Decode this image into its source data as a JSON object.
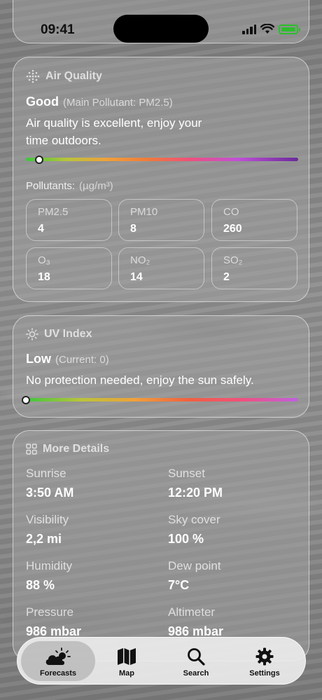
{
  "status_bar": {
    "time": "09:41"
  },
  "air_quality": {
    "header": "Air Quality",
    "level": "Good",
    "main_pollutant": "(Main Pollutant: PM2.5)",
    "description_line1": "Air quality is excellent, enjoy your",
    "description_line2": "time outdoors.",
    "scale_position": 0.05,
    "pollutants_label": "Pollutants:",
    "pollutants_unit": "(µg/m³)",
    "pollutants": [
      {
        "name": "PM2.5",
        "value": "4"
      },
      {
        "name": "PM10",
        "value": "8"
      },
      {
        "name": "CO",
        "value": "260"
      },
      {
        "name": "O₃",
        "value": "18"
      },
      {
        "name": "NO₂",
        "value": "14"
      },
      {
        "name": "SO₂",
        "value": "2"
      }
    ]
  },
  "uv_index": {
    "header": "UV Index",
    "level": "Low",
    "current": "(Current: 0)",
    "description": "No protection needed, enjoy the sun safely.",
    "scale_position": 0.0
  },
  "more_details": {
    "header": "More Details",
    "items": [
      {
        "label": "Sunrise",
        "value": "3:50 AM"
      },
      {
        "label": "Sunset",
        "value": "12:20 PM"
      },
      {
        "label": "Visibility",
        "value": "2,2 mi"
      },
      {
        "label": "Sky cover",
        "value": "100 %"
      },
      {
        "label": "Humidity",
        "value": "88 %"
      },
      {
        "label": "Dew point",
        "value": "7°C"
      },
      {
        "label": "Pressure",
        "value": "986 mbar"
      },
      {
        "label": "Altimeter",
        "value": "986 mbar"
      }
    ]
  },
  "tab_bar": {
    "tabs": [
      {
        "label": "Forecasts",
        "icon": "cloud-sun-icon",
        "active": true
      },
      {
        "label": "Map",
        "icon": "map-icon",
        "active": false
      },
      {
        "label": "Search",
        "icon": "search-icon",
        "active": false
      },
      {
        "label": "Settings",
        "icon": "gear-icon",
        "active": false
      }
    ]
  }
}
